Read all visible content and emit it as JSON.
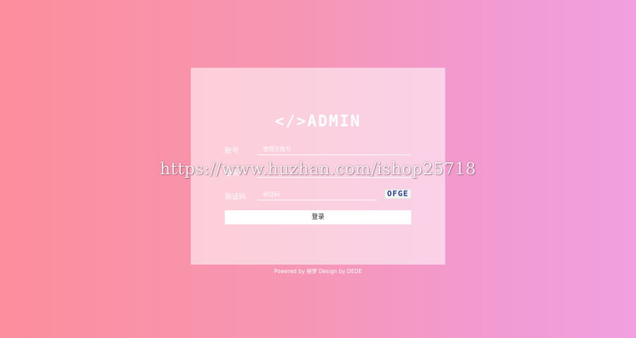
{
  "theme": {
    "gradient_start": "#fc8e9d",
    "gradient_end": "#f2a0e0",
    "panel_color": "#ffffff",
    "captcha_text_color": "#2a3d8f"
  },
  "logo": {
    "text": "</>ADMIN"
  },
  "form": {
    "account_label": "账号",
    "account_placeholder": "管理员账号",
    "password_label": "密码",
    "password_placeholder": "",
    "captcha_label": "验证码",
    "captcha_placeholder": "验证码",
    "captcha_text": "OFGE",
    "login_label": "登录"
  },
  "footer": {
    "text": "Powered by 程梦 Design by DEDE"
  },
  "watermark": {
    "text": "https://www.huzhan.com/ishop25718"
  },
  "icons": {
    "logo": "code-brackets-icon"
  }
}
